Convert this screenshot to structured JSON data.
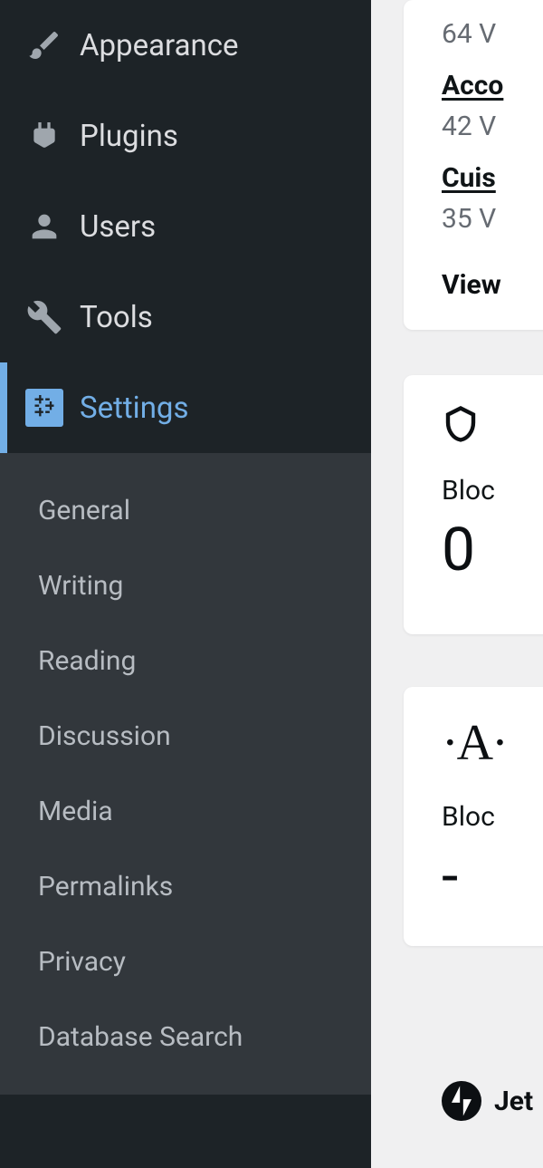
{
  "sidebar": {
    "items": [
      {
        "label": "Appearance"
      },
      {
        "label": "Plugins"
      },
      {
        "label": "Users"
      },
      {
        "label": "Tools"
      },
      {
        "label": "Settings"
      }
    ],
    "submenu": [
      {
        "label": "General"
      },
      {
        "label": "Writing"
      },
      {
        "label": "Reading"
      },
      {
        "label": "Discussion"
      },
      {
        "label": "Media"
      },
      {
        "label": "Permalinks"
      },
      {
        "label": "Privacy"
      },
      {
        "label": "Database Search"
      }
    ]
  },
  "content": {
    "rows": [
      {
        "value": "64 V"
      },
      {
        "title": "Acco",
        "value": "42 V"
      },
      {
        "title": "Cuis",
        "value": "35 V"
      }
    ],
    "view_link": "View",
    "card1": {
      "label": "Bloc",
      "value": "0"
    },
    "card2": {
      "label": "Bloc",
      "value": "-"
    },
    "footer": {
      "label": "Jet"
    }
  }
}
